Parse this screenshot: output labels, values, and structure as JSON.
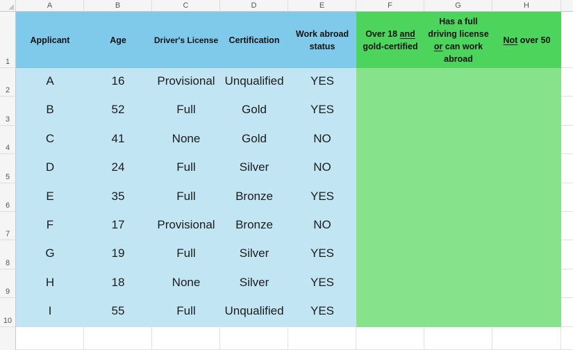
{
  "spreadsheet": {
    "column_headers": [
      "A",
      "B",
      "C",
      "D",
      "E",
      "F",
      "G",
      "H"
    ],
    "row_headers": [
      "1",
      "2",
      "3",
      "4",
      "5",
      "6",
      "7",
      "8",
      "9",
      "10"
    ],
    "table_headers": {
      "applicant": "Applicant",
      "age": "Age",
      "drivers_license": "Driver's License",
      "certification": "Certification",
      "work_abroad": {
        "line1": "Work abroad",
        "line2": "status"
      },
      "over18_gold": {
        "part1": "Over 18 ",
        "underlined": "and",
        "part2": "gold-certified"
      },
      "full_license_or_abroad": {
        "line1": "Has a full",
        "line2": "driving license",
        "underlined": "or",
        "line3_rest": " can work",
        "line4": "abroad"
      },
      "not_over_50": {
        "underlined": "Not",
        "rest": " over 50"
      }
    },
    "rows": [
      {
        "applicant": "A",
        "age": "16",
        "license": "Provisional",
        "certification": "Unqualified",
        "work_abroad": "YES",
        "f": "",
        "g": "",
        "h": ""
      },
      {
        "applicant": "B",
        "age": "52",
        "license": "Full",
        "certification": "Gold",
        "work_abroad": "YES",
        "f": "",
        "g": "",
        "h": ""
      },
      {
        "applicant": "C",
        "age": "41",
        "license": "None",
        "certification": "Gold",
        "work_abroad": "NO",
        "f": "",
        "g": "",
        "h": ""
      },
      {
        "applicant": "D",
        "age": "24",
        "license": "Full",
        "certification": "Silver",
        "work_abroad": "NO",
        "f": "",
        "g": "",
        "h": ""
      },
      {
        "applicant": "E",
        "age": "35",
        "license": "Full",
        "certification": "Bronze",
        "work_abroad": "YES",
        "f": "",
        "g": "",
        "h": ""
      },
      {
        "applicant": "F",
        "age": "17",
        "license": "Provisional",
        "certification": "Bronze",
        "work_abroad": "NO",
        "f": "",
        "g": "",
        "h": ""
      },
      {
        "applicant": "G",
        "age": "19",
        "license": "Full",
        "certification": "Silver",
        "work_abroad": "YES",
        "f": "",
        "g": "",
        "h": ""
      },
      {
        "applicant": "H",
        "age": "18",
        "license": "None",
        "certification": "Silver",
        "work_abroad": "YES",
        "f": "",
        "g": "",
        "h": ""
      },
      {
        "applicant": "I",
        "age": "55",
        "license": "Full",
        "certification": "Unqualified",
        "work_abroad": "YES",
        "f": "",
        "g": "",
        "h": ""
      }
    ],
    "colors": {
      "header_blue": "#7fcaea",
      "data_blue": "#c2e5f4",
      "header_green": "#4cd45c",
      "data_green": "#86e38c"
    }
  }
}
